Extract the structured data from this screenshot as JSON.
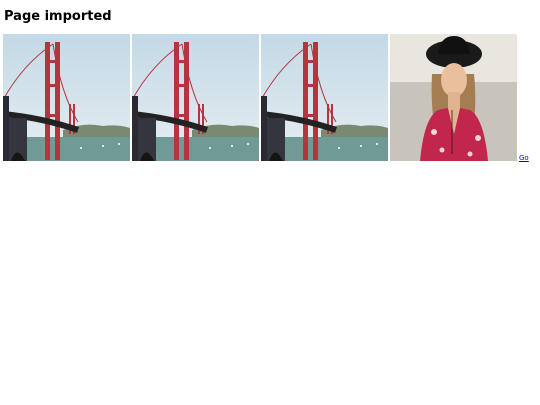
{
  "page": {
    "title": "Page imported"
  },
  "images": [
    {
      "subject": "Golden Gate Bridge photo",
      "icon": "bridge-photo"
    },
    {
      "subject": "Golden Gate Bridge photo",
      "icon": "bridge-photo"
    },
    {
      "subject": "Golden Gate Bridge photo",
      "icon": "bridge-photo"
    },
    {
      "subject": "Portrait of woman in black hat",
      "icon": "portrait-photo"
    }
  ],
  "link": {
    "label": "Go"
  },
  "colors": {
    "link": "#0000ee",
    "bridge_red": "#b5343e",
    "sky": "#cfe0ea",
    "water": "#6f9a96"
  }
}
